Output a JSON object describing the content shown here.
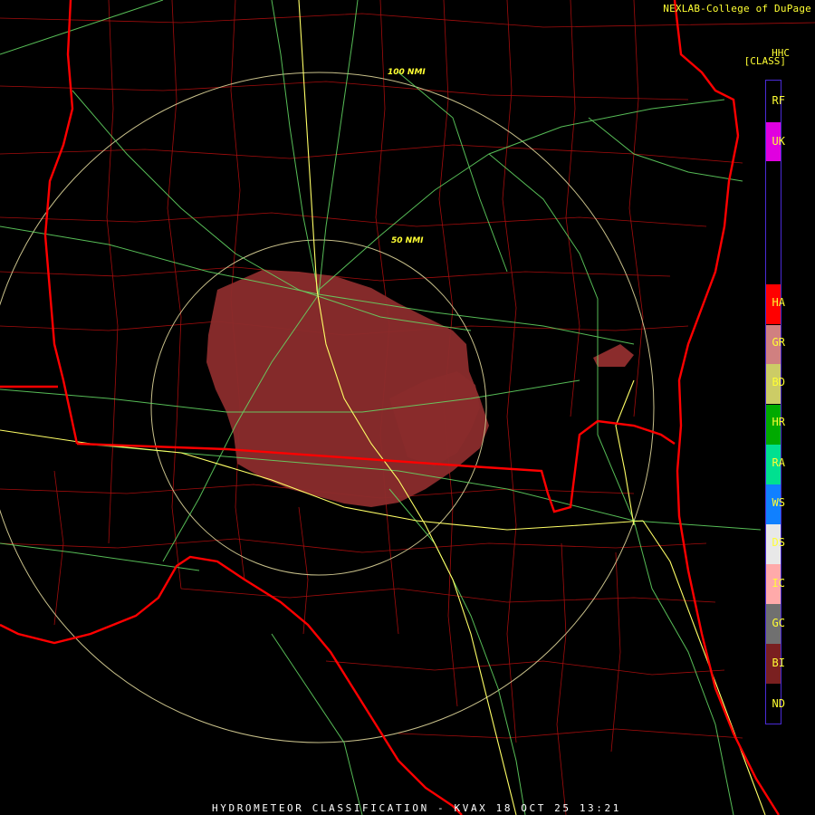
{
  "header": {
    "credit": "NEXLAB-College of DuPage",
    "product": "HHC",
    "product_sub": "[CLASS]"
  },
  "range_rings": [
    {
      "label": "100 NMI"
    },
    {
      "label": "50 NMI"
    }
  ],
  "legend": [
    {
      "code": "RF",
      "color": "#7010ff"
    },
    {
      "code": "UK",
      "color": "#e000e0"
    },
    {
      "code": "HA",
      "color": "#ff0000"
    },
    {
      "code": "GR",
      "color": "#d08080"
    },
    {
      "code": "BD",
      "color": "#cccc66"
    },
    {
      "code": "HR",
      "color": "#00aa00"
    },
    {
      "code": "RA",
      "color": "#00e090"
    },
    {
      "code": "WS",
      "color": "#1080ff"
    },
    {
      "code": "DS",
      "color": "#e8e8e8"
    },
    {
      "code": "IC",
      "color": "#ffaaaa"
    },
    {
      "code": "GC",
      "color": "#707070"
    },
    {
      "code": "BI",
      "color": "#7a2020"
    },
    {
      "code": "ND",
      "color": "#000000"
    }
  ],
  "colors": {
    "state_border": "#ff0000",
    "county_border": "#c01010",
    "interstate": "#ffff66",
    "highway": "#66dd66",
    "echo": "#8b2c2c",
    "ring": "#c8c08a"
  },
  "footer": {
    "title": "HYDROMETEOR CLASSIFICATION - KVAX 18 OCT 25 13:21"
  }
}
